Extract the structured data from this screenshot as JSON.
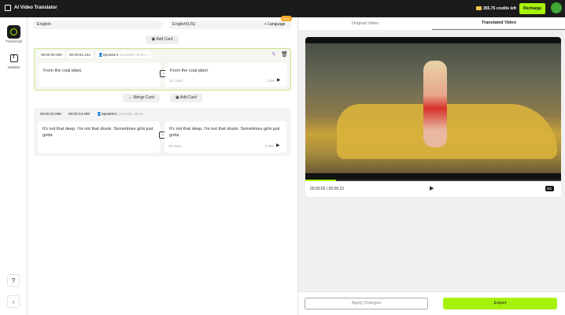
{
  "header": {
    "title": "AI Video Translator",
    "credits": "355.75 credits left",
    "recharge": "Recharge"
  },
  "sidebar": {
    "items": [
      {
        "label": "Transcript"
      },
      {
        "label": "Subtitle"
      }
    ],
    "help": "?",
    "collapse": "‹"
  },
  "languages": {
    "source": "English",
    "target": "English(US)",
    "add_language": "Language",
    "new_badge": "New"
  },
  "add_card": "Add Card",
  "merge_card": "Merge Card",
  "cards": [
    {
      "start": "00:00:00.000",
      "end": "00:00:01.224",
      "speaker": "Speaker1",
      "speaker_note": "(Acoustic clone)",
      "source_text": "From the coal plant.",
      "target_text": "From the coal plant.",
      "chars": "20 chars",
      "duration": "1.09s"
    },
    {
      "start": "00:00:10.080",
      "end": "00:00:13.459",
      "speaker": "Speaker1",
      "speaker_note": "(Acoustic clone)",
      "source_text": "It's not that deep. I'm not that drunk. Sometimes girls just gotta",
      "target_text": "It's not that deep. I'm not that drunk. Sometimes girls just gotta",
      "chars": "66 chars",
      "duration": "0.98s"
    }
  ],
  "tabs": [
    {
      "label": "Original Video"
    },
    {
      "label": "Translated Video"
    }
  ],
  "player": {
    "time": "00:00:02 / 00:00:22",
    "progress": 0.12,
    "cc": "CC"
  },
  "footer": {
    "apply": "Apply Changes",
    "export": "Export"
  },
  "colors": {
    "accent": "#a6f20a"
  }
}
